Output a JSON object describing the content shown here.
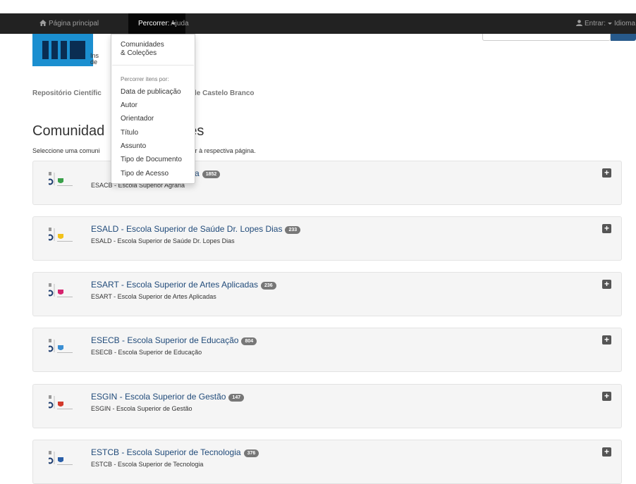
{
  "navbar": {
    "home_label": "Página principal",
    "browse_label": "Percorrer:",
    "help_label": "Ajuda",
    "login_label": "Entrar:",
    "language_label": "Idioma"
  },
  "logo": {
    "line1": "Ins",
    "line2": "de"
  },
  "breadcrumb": {
    "left": "Repositório Científic",
    "right": "o de Castelo Branco"
  },
  "page": {
    "title_left": "Comunidad",
    "title_right": "es",
    "desc_left": "Seleccione uma comuni",
    "desc_right": "eder à respectiva página."
  },
  "dropdown": {
    "communities_line1": "Comunidades",
    "communities_line2": "& Coleções",
    "browse_by_header": "Percorrer itens por:",
    "items": [
      "Data de publicação",
      "Autor",
      "Orientador",
      "Título",
      "Assunto",
      "Tipo de Documento",
      "Tipo de Acesso"
    ]
  },
  "communities": [
    {
      "title": "ESACB - Escola Superior Agrária",
      "title_visible": "grária",
      "count": "1852",
      "subtitle": "ESACB - Escola Superior Agrária",
      "shield_color": "#3aa04a"
    },
    {
      "title": "ESALD - Escola Superior de Saúde Dr. Lopes Dias",
      "count": "233",
      "subtitle": "ESALD - Escola Superior de Saúde Dr. Lopes Dias",
      "shield_color": "#f2c21b"
    },
    {
      "title": "ESART - Escola Superior de Artes Aplicadas",
      "count": "236",
      "subtitle": "ESART - Escola Superior de Artes Aplicadas",
      "shield_color": "#d6246e"
    },
    {
      "title": "ESECB - Escola Superior de Educação",
      "count": "804",
      "subtitle": "ESECB - Escola Superior de Educação",
      "shield_color": "#3b8fd3"
    },
    {
      "title": "ESGIN - Escola Superior de Gestão",
      "count": "147",
      "subtitle": "ESGIN - Escola Superior de Gestão",
      "shield_color": "#d33a2c"
    },
    {
      "title": "ESTCB - Escola Superior de Tecnologia",
      "count": "376",
      "subtitle": "ESTCB - Escola Superior de Tecnologia",
      "shield_color": "#2a5fa8"
    }
  ]
}
